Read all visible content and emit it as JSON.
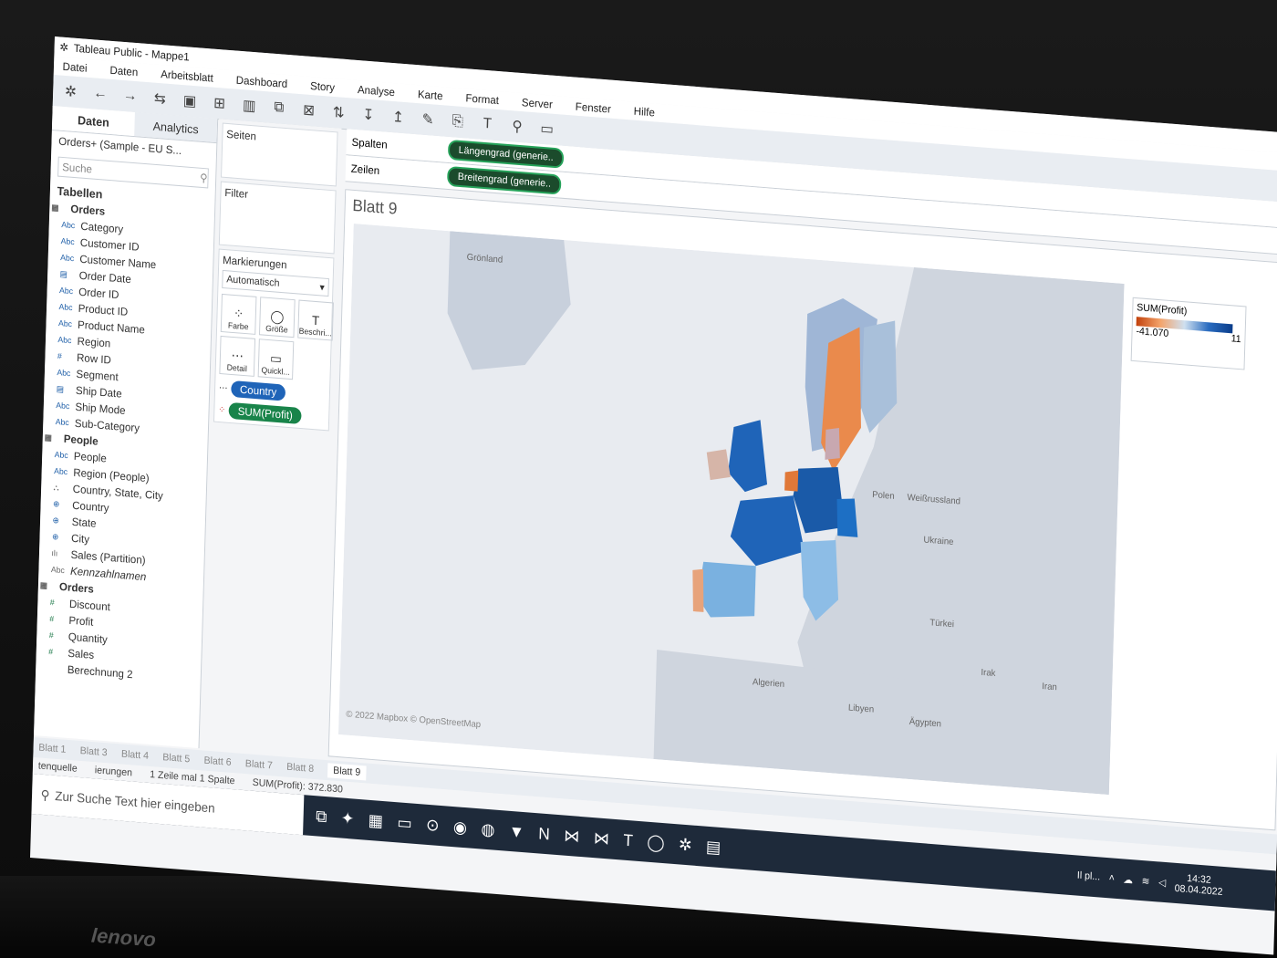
{
  "window": {
    "title": "Tableau Public - Mappe1"
  },
  "menu": [
    "Datei",
    "Daten",
    "Arbeitsblatt",
    "Dashboard",
    "Story",
    "Analyse",
    "Karte",
    "Format",
    "Server",
    "Fenster",
    "Hilfe"
  ],
  "data_pane": {
    "tab_data": "Daten",
    "tab_analytics": "Analytics",
    "source": "Orders+ (Sample - EU S...",
    "search_placeholder": "Suche",
    "tables_heading": "Tabellen",
    "orders_table": "Orders",
    "orders_fields": [
      "Category",
      "Customer ID",
      "Customer Name",
      "Order Date",
      "Order ID",
      "Product ID",
      "Product Name",
      "Region",
      "Row ID",
      "Segment",
      "Ship Date",
      "Ship Mode",
      "Sub-Category"
    ],
    "orders_icons": [
      "Abc",
      "Abc",
      "Abc",
      "date",
      "Abc",
      "Abc",
      "Abc",
      "Abc",
      "#",
      "Abc",
      "date",
      "Abc",
      "Abc"
    ],
    "people_table": "People",
    "people_fields": [
      "People",
      "Region (People)"
    ],
    "hierarchy": "Country, State, City",
    "geo_fields": [
      "Country",
      "State",
      "City"
    ],
    "sales_partition": "Sales (Partition)",
    "measure_names": "Kennzahlnamen",
    "measures_table": "Orders",
    "measures": [
      "Discount",
      "Profit",
      "Quantity",
      "Sales"
    ],
    "calc": "Berechnung 2"
  },
  "cards": {
    "pages": "Seiten",
    "filter": "Filter",
    "marks": "Markierungen",
    "mark_type": "Automatisch",
    "mark_buttons": [
      "Farbe",
      "Größe",
      "Beschri...",
      "Detail",
      "Quickl..."
    ],
    "pill_country": "Country",
    "pill_profit": "SUM(Profit)"
  },
  "shelves": {
    "columns_label": "Spalten",
    "columns_pill": "Längengrad (generie..",
    "rows_label": "Zeilen",
    "rows_pill": "Breitengrad (generie.."
  },
  "view": {
    "sheet_title": "Blatt 9",
    "map_labels": [
      "Grönland",
      "Polen",
      "Weißrussland",
      "Ukraine",
      "Türkei",
      "Algerien",
      "Libyen",
      "Ägypten",
      "Irak",
      "Iran"
    ],
    "attribution": "© 2022 Mapbox © OpenStreetMap"
  },
  "legend": {
    "title": "SUM(Profit)",
    "min": "-41.070",
    "max": "11"
  },
  "sheet_tabs": [
    "Blatt 1",
    "Blatt 3",
    "Blatt 4",
    "Blatt 5",
    "Blatt 6",
    "Blatt 7",
    "Blatt 8",
    "Blatt 9"
  ],
  "status": {
    "source": "tenquelle",
    "marks": "ierungen",
    "layout": "1 Zeile mal 1 Spalte",
    "sum": "SUM(Profit): 372.830"
  },
  "taskbar": {
    "search_placeholder": "Zur Suche Text hier eingeben",
    "weather": "Il pl...",
    "time": "14:32",
    "date": "08.04.2022"
  },
  "colors": {
    "accent_blue": "#1f64b8",
    "accent_green": "#19844a",
    "loss_orange": "#e8874a",
    "gain_blue": "#2a6cc0"
  }
}
